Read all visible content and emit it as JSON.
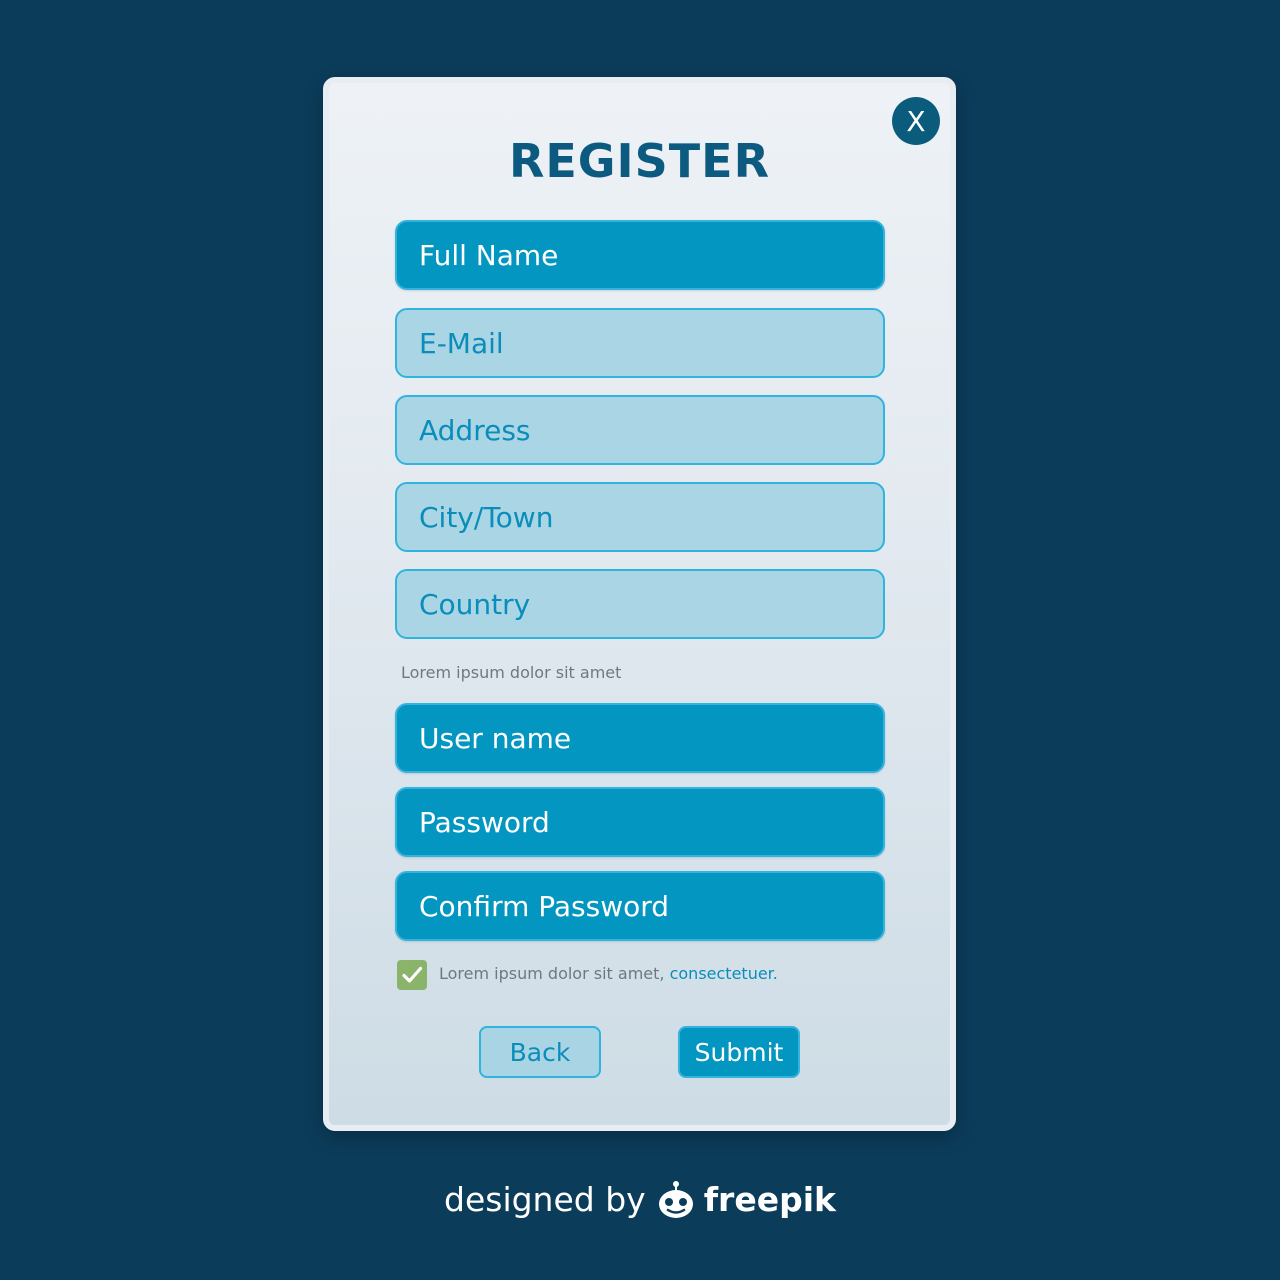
{
  "dialog": {
    "title": "REGISTER",
    "close_label": "X"
  },
  "fields": {
    "full_name": {
      "label": "Full Name",
      "state": "active"
    },
    "email": {
      "label": "E-Mail",
      "state": "inactive"
    },
    "address": {
      "label": "Address",
      "state": "inactive"
    },
    "city": {
      "label": "City/Town",
      "state": "inactive"
    },
    "country": {
      "label": "Country",
      "state": "inactive"
    },
    "username": {
      "label": "User name",
      "state": "active"
    },
    "password": {
      "label": "Password",
      "state": "active"
    },
    "confirm_password": {
      "label": "Confirm Password",
      "state": "active"
    }
  },
  "hint_text": "Lorem ipsum dolor sit amet",
  "agreement": {
    "checked": true,
    "text": "Lorem ipsum dolor sit amet,",
    "link_text": "consectetuer",
    "suffix": "."
  },
  "buttons": {
    "back_label": "Back",
    "submit_label": "Submit"
  },
  "credit": {
    "prefix": "designed by",
    "brand": "freepik",
    "icon": "freepik-logo-icon"
  },
  "colors": {
    "background": "#0b3c5a",
    "accent": "#0396c1",
    "title": "#0d5a80",
    "inactive_field": "#aad5e4",
    "checkbox": "#8ab46a"
  }
}
